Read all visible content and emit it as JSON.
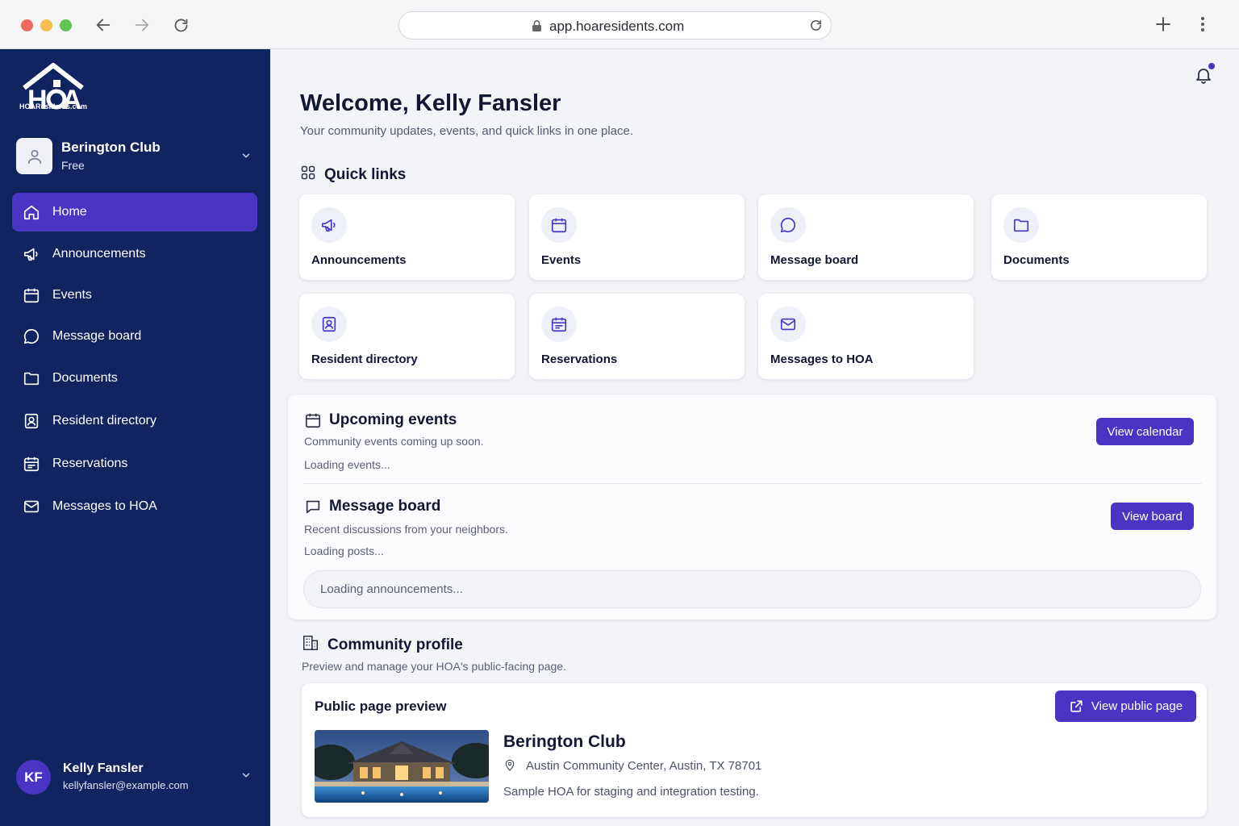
{
  "browser": {
    "url": "app.hoaresidents.com"
  },
  "sidebar": {
    "logo_text": "HOAResidents.com",
    "org": {
      "name": "Berington Club",
      "plan": "Free"
    },
    "items": [
      {
        "label": "Home",
        "icon": "home-icon"
      },
      {
        "label": "Announcements",
        "icon": "megaphone-icon"
      },
      {
        "label": "Events",
        "icon": "calendar-icon"
      },
      {
        "label": "Message board",
        "icon": "chat-bubble-icon"
      },
      {
        "label": "Documents",
        "icon": "folder-icon"
      },
      {
        "label": "Resident directory",
        "icon": "contact-card-icon"
      },
      {
        "label": "Reservations",
        "icon": "calendar-list-icon"
      },
      {
        "label": "Messages to HOA",
        "icon": "envelope-icon"
      }
    ],
    "user": {
      "initials": "KF",
      "name": "Kelly Fansler",
      "email": "kellyfansler@example.com"
    }
  },
  "main": {
    "welcome": "Welcome, Kelly Fansler",
    "subtitle": "Your community updates, events, and quick links in one place.",
    "quick_links": {
      "title": "Quick links",
      "items": [
        {
          "label": "Announcements",
          "icon": "megaphone-icon"
        },
        {
          "label": "Events",
          "icon": "calendar-icon"
        },
        {
          "label": "Message board",
          "icon": "chat-bubble-icon"
        },
        {
          "label": "Documents",
          "icon": "folder-icon"
        },
        {
          "label": "Resident directory",
          "icon": "contact-card-icon"
        },
        {
          "label": "Reservations",
          "icon": "calendar-list-icon"
        },
        {
          "label": "Messages to HOA",
          "icon": "envelope-icon"
        }
      ]
    },
    "upcoming_events": {
      "title": "Upcoming events",
      "subtitle": "Community events coming up soon.",
      "loading": "Loading events...",
      "button": "View calendar"
    },
    "message_board": {
      "title": "Message board",
      "subtitle": "Recent discussions from your neighbors.",
      "loading": "Loading posts...",
      "button": "View board"
    },
    "announcements_loading": "Loading announcements...",
    "community_profile": {
      "title": "Community profile",
      "subtitle": "Preview and manage your HOA's public-facing page.",
      "card_title": "Public page preview",
      "button": "View public page",
      "name": "Berington Club",
      "address": "Austin Community Center, Austin, TX 78701",
      "description": "Sample HOA for staging and integration testing."
    }
  },
  "colors": {
    "sidebar": "#10245f",
    "accent": "#4a34c4",
    "background": "#f3f4f8"
  }
}
